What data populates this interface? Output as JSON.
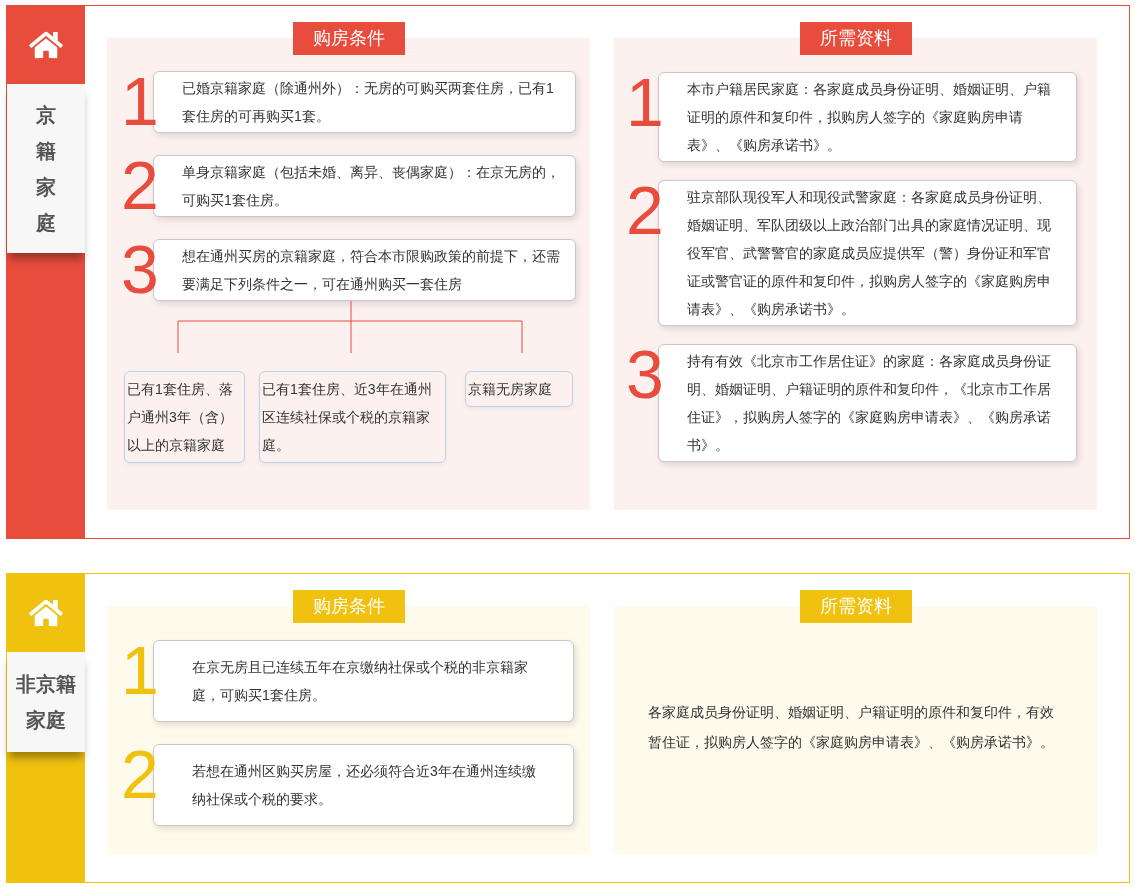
{
  "sections": [
    {
      "color": "#e84c3d",
      "label": "京籍家庭",
      "kind": "vertical",
      "conditions": {
        "title": "购房条件",
        "items": [
          {
            "number": "1",
            "text": "已婚京籍家庭（除通州外）：无房的可购买两套住房，已有1套住房的可再购买1套。"
          },
          {
            "number": "2",
            "text": "单身京籍家庭（包括未婚、离异、丧偶家庭）：在京无房的，可购买1套住房。"
          },
          {
            "number": "3",
            "text": "想在通州买房的京籍家庭，符合本市限购政策的前提下，还需要满足下列条件之一，可在通州购买一套住房",
            "children": [
              {
                "text": "已有1套住房、落户通州3年（含）以上的京籍家庭"
              },
              {
                "text": "已有1套住房、近3年在通州区连续社保或个税的京籍家庭。"
              },
              {
                "text": "京籍无房家庭"
              }
            ]
          }
        ]
      },
      "materials": {
        "title": "所需资料",
        "items": [
          {
            "number": "1",
            "text": "本市户籍居民家庭：各家庭成员身份证明、婚姻证明、户籍证明的原件和复印件，拟购房人签字的《家庭购房申请表》、《购房承诺书》。"
          },
          {
            "number": "2",
            "text": "驻京部队现役军人和现役武警家庭：各家庭成员身份证明、婚姻证明、军队团级以上政治部门出具的家庭情况证明、现役军官、武警警官的家庭成员应提供军（警）身份证和军官证或警官证的原件和复印件，拟购房人签字的《家庭购房申请表》、《购房承诺书》。"
          },
          {
            "number": "3",
            "text": "持有有效《北京市工作居住证》的家庭：各家庭成员身份证明、婚姻证明、户籍证明的原件和复印件，《北京市工作居住证》，拟购房人签字的《家庭购房申请表》、《购房承诺书》。"
          }
        ]
      }
    },
    {
      "color": "#f0c20f",
      "label": "非京籍家庭",
      "kind": "wrapped",
      "conditions": {
        "title": "购房条件",
        "items": [
          {
            "number": "1",
            "text": "在京无房且已连续五年在京缴纳社保或个税的非京籍家庭，可购买1套住房。"
          },
          {
            "number": "2",
            "text": "若想在通州区购买房屋，还必须符合近3年在通州连续缴纳社保或个税的要求。"
          }
        ]
      },
      "materials": {
        "title": "所需资料",
        "text": "各家庭成员身份证明、婚姻证明、户籍证明的原件和复印件，有效暂住证，拟购房人签字的《家庭购房申请表》、《购房承诺书》。"
      }
    }
  ]
}
